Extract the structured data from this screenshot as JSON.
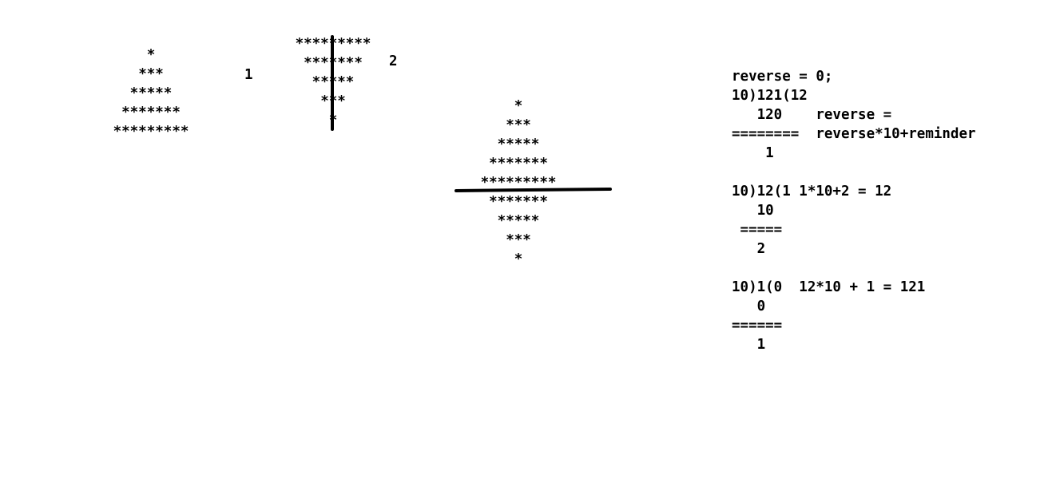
{
  "pattern_1": {
    "rows": [
      "*",
      "***",
      "*****",
      "*******",
      "*********"
    ],
    "label": "1"
  },
  "pattern_2": {
    "rows": [
      "*********",
      "*******",
      "*****",
      "***",
      "*"
    ],
    "label": "2"
  },
  "diamond": {
    "rows": [
      "*",
      "***",
      "*****",
      "*******",
      "*********",
      "*******",
      "*****",
      "***",
      "*"
    ]
  },
  "reverse_notes": {
    "lines": [
      "reverse = 0;",
      "10)121(12",
      "   120    reverse =",
      "========  reverse*10+reminder",
      "    1",
      "",
      "10)12(1 1*10+2 = 12",
      "   10",
      " =====",
      "   2",
      "",
      "10)1(0  12*10 + 1 = 121",
      "   0",
      "======",
      "   1"
    ]
  }
}
